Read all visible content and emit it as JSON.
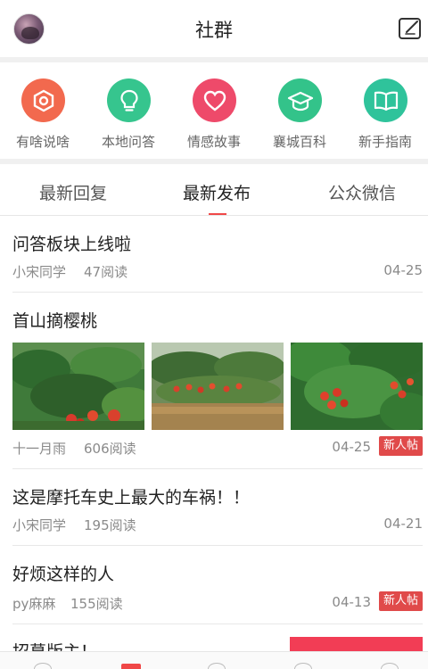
{
  "header": {
    "title": "社群"
  },
  "categories": [
    {
      "label": "有啥说啥",
      "color": "#f2694e",
      "icon": "hexagon-target-icon"
    },
    {
      "label": "本地问答",
      "color": "#36c58e",
      "icon": "lightbulb-icon"
    },
    {
      "label": "情感故事",
      "color": "#ee4a6a",
      "icon": "heart-icon"
    },
    {
      "label": "襄城百科",
      "color": "#33c38a",
      "icon": "graduation-cap-icon"
    },
    {
      "label": "新手指南",
      "color": "#2fc39b",
      "icon": "book-icon"
    }
  ],
  "tabs": [
    {
      "label": "最新回复"
    },
    {
      "label": "最新发布"
    },
    {
      "label": "公众微信"
    }
  ],
  "posts": [
    {
      "title": "问答板块上线啦",
      "author": "小宋同学",
      "reads": "47阅读",
      "date": "04-25"
    },
    {
      "title": "首山摘樱桃",
      "author": "十一月雨",
      "reads": "606阅读",
      "date": "04-25",
      "badge": "新人帖"
    },
    {
      "title": "这是摩托车史上最大的车祸！！",
      "author": "小宋同学",
      "reads": "195阅读",
      "date": "04-21"
    },
    {
      "title": "好烦这样的人",
      "author": "py麻麻",
      "reads": "155阅读",
      "date": "04-13",
      "badge": "新人帖"
    },
    {
      "title": "招募版主！"
    }
  ]
}
